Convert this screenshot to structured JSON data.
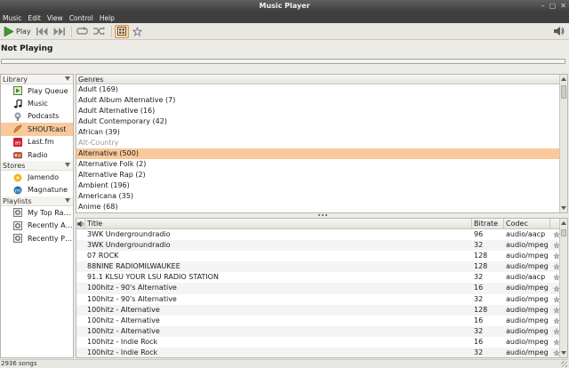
{
  "window": {
    "title": "Music Player",
    "controls": [
      "–",
      "▢",
      "✕"
    ]
  },
  "menu": [
    "Music",
    "Edit",
    "View",
    "Control",
    "Help"
  ],
  "toolbar": {
    "play_label": "Play",
    "icons": [
      "play-icon",
      "previous-icon",
      "next-icon",
      "repeat-icon",
      "shuffle-icon",
      "browse-icon",
      "star-icon",
      "volume-icon"
    ]
  },
  "now_playing": "Not Playing",
  "progress": {
    "value": 0
  },
  "sidebar": {
    "sections": [
      {
        "title": "Library",
        "items": [
          {
            "label": "Play Queue",
            "icon": "play-queue-icon"
          },
          {
            "label": "Music",
            "icon": "music-note-icon"
          },
          {
            "label": "Podcasts",
            "icon": "podcast-icon"
          },
          {
            "label": "SHOUTcast",
            "icon": "shoutcast-icon",
            "selected": true
          },
          {
            "label": "Last.fm",
            "icon": "lastfm-icon"
          },
          {
            "label": "Radio",
            "icon": "radio-icon"
          }
        ]
      },
      {
        "title": "Stores",
        "items": [
          {
            "label": "Jamendo",
            "icon": "jamendo-icon"
          },
          {
            "label": "Magnatune",
            "icon": "magnatune-icon"
          }
        ]
      },
      {
        "title": "Playlists",
        "items": [
          {
            "label": "My Top Rated",
            "icon": "smart-playlist-icon"
          },
          {
            "label": "Recently Ad...",
            "icon": "smart-playlist-icon"
          },
          {
            "label": "Recently Pla...",
            "icon": "smart-playlist-icon"
          }
        ]
      }
    ]
  },
  "genres": {
    "header": "Genres",
    "rows": [
      {
        "label": "Adult (169)"
      },
      {
        "label": "Adult Album Alternative (7)"
      },
      {
        "label": "Adult Alternative (16)"
      },
      {
        "label": "Adult Contemporary (42)"
      },
      {
        "label": "African (39)"
      },
      {
        "label": "Alt-Country",
        "dim": true
      },
      {
        "label": "Alternative (500)",
        "selected": true
      },
      {
        "label": "Alternative Folk (2)"
      },
      {
        "label": "Alternative Rap (2)"
      },
      {
        "label": "Ambient (196)"
      },
      {
        "label": "Americana (35)"
      },
      {
        "label": "Anime (68)"
      }
    ]
  },
  "songs": {
    "columns": {
      "title": "Title",
      "bitrate": "Bitrate",
      "codec": "Codec"
    },
    "rows": [
      {
        "title": "3WK Undergroundradio",
        "bitrate": "96",
        "codec": "audio/aacp"
      },
      {
        "title": "3WK Undergroundradio",
        "bitrate": "32",
        "codec": "audio/mpeg"
      },
      {
        "title": "07 ROCK",
        "bitrate": "128",
        "codec": "audio/mpeg"
      },
      {
        "title": "88NINE RADIOMILWAUKEE",
        "bitrate": "128",
        "codec": "audio/mpeg"
      },
      {
        "title": "91.1 KLSU YOUR LSU RADIO STATION",
        "bitrate": "32",
        "codec": "audio/aacp"
      },
      {
        "title": "100hitz - 90's Alternative",
        "bitrate": "16",
        "codec": "audio/mpeg"
      },
      {
        "title": "100hitz - 90's Alternative",
        "bitrate": "32",
        "codec": "audio/mpeg"
      },
      {
        "title": "100hitz - Alternative",
        "bitrate": "128",
        "codec": "audio/mpeg"
      },
      {
        "title": "100hitz - Alternative",
        "bitrate": "16",
        "codec": "audio/mpeg"
      },
      {
        "title": "100hitz - Alternative",
        "bitrate": "32",
        "codec": "audio/mpeg"
      },
      {
        "title": "100hitz - Indie Rock",
        "bitrate": "16",
        "codec": "audio/mpeg"
      },
      {
        "title": "100hitz - Indie Rock",
        "bitrate": "32",
        "codec": "audio/mpeg"
      }
    ]
  },
  "status": "2936 songs"
}
